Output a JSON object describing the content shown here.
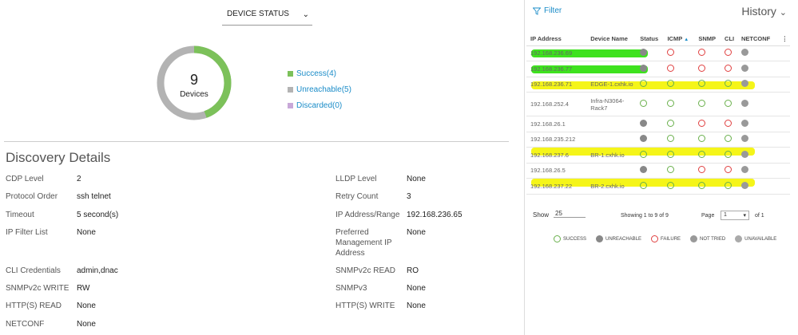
{
  "status_select": {
    "value": "DEVICE STATUS"
  },
  "donut": {
    "count": "9",
    "label": "Devices",
    "success": 4,
    "unreachable": 5,
    "discarded": 0
  },
  "legend": [
    {
      "label": "Success(4)",
      "color": "#7cc15a"
    },
    {
      "label": "Unreachable(5)",
      "color": "#b3b3b3"
    },
    {
      "label": "Discarded(0)",
      "color": "#c8a8d8"
    }
  ],
  "details": {
    "title": "Discovery Details",
    "rows": [
      {
        "k": "CDP Level",
        "v": "2"
      },
      {
        "k": "Protocol Order",
        "v": "ssh telnet"
      },
      {
        "k": "Timeout",
        "v": "5 second(s)"
      },
      {
        "k": "IP Filter List",
        "v": "None"
      },
      {
        "k": "CLI Credentials",
        "v": "admin,dnac"
      },
      {
        "k": "SNMPv2c WRITE",
        "v": "RW"
      },
      {
        "k": "HTTP(S) READ",
        "v": "None"
      },
      {
        "k": "NETCONF",
        "v": "None"
      },
      {
        "k": "LLDP Level",
        "v": "None"
      },
      {
        "k": "Retry Count",
        "v": "3"
      },
      {
        "k": "IP Address/Range",
        "v": "192.168.236.65"
      },
      {
        "k": "Preferred Management IP Address",
        "v": "None"
      },
      {
        "k": "SNMPv2c READ",
        "v": "RO"
      },
      {
        "k": "SNMPv3",
        "v": "None"
      },
      {
        "k": "HTTP(S) WRITE",
        "v": "None"
      }
    ]
  },
  "panel": {
    "filter": "Filter",
    "history": "History",
    "headers": [
      "IP Address",
      "Device Name",
      "Status",
      "ICMP",
      "SNMP",
      "CLI",
      "NETCONF"
    ],
    "rows": [
      {
        "ip": "192.168.236.69",
        "name": "",
        "st": "unr",
        "icmp": "fail",
        "snmp": "fail",
        "cli": "fail",
        "nc": "nt"
      },
      {
        "ip": "192.168.236.77",
        "name": "",
        "st": "unr",
        "icmp": "fail",
        "snmp": "fail",
        "cli": "fail",
        "nc": "nt"
      },
      {
        "ip": "192.168.236.71",
        "name": "EDGE-1.cxhk.io",
        "st": "succ",
        "icmp": "succ",
        "snmp": "succ",
        "cli": "succ",
        "nc": "nt"
      },
      {
        "ip": "192.168.252.4",
        "name": "Infra-N3064-Rack7",
        "st": "succ",
        "icmp": "succ",
        "snmp": "succ",
        "cli": "succ",
        "nc": "nt"
      },
      {
        "ip": "192.168.26.1",
        "name": "",
        "st": "unr",
        "icmp": "succ",
        "snmp": "fail",
        "cli": "fail",
        "nc": "nt"
      },
      {
        "ip": "192.168.235.212",
        "name": "",
        "st": "unr",
        "icmp": "succ",
        "snmp": "succ",
        "cli": "succ",
        "nc": "nt"
      },
      {
        "ip": "192.168.237.6",
        "name": "BR-1.cxhk.io",
        "st": "succ",
        "icmp": "succ",
        "snmp": "succ",
        "cli": "succ",
        "nc": "nt"
      },
      {
        "ip": "192.168.26.5",
        "name": "",
        "st": "unr",
        "icmp": "succ",
        "snmp": "fail",
        "cli": "fail",
        "nc": "nt"
      },
      {
        "ip": "192.168.237.22",
        "name": "BR-2.cxhk.io",
        "st": "succ",
        "icmp": "succ",
        "snmp": "succ",
        "cli": "succ",
        "nc": "nt"
      }
    ],
    "show_label": "Show",
    "show_value": "25",
    "showing": "Showing 1 to 9 of 9",
    "page_label": "Page",
    "page_value": "1",
    "page_of": "of 1",
    "keys": [
      "SUCCESS",
      "UNREACHABLE",
      "FAILURE",
      "NOT TRIED",
      "UNAVAILABLE"
    ]
  }
}
